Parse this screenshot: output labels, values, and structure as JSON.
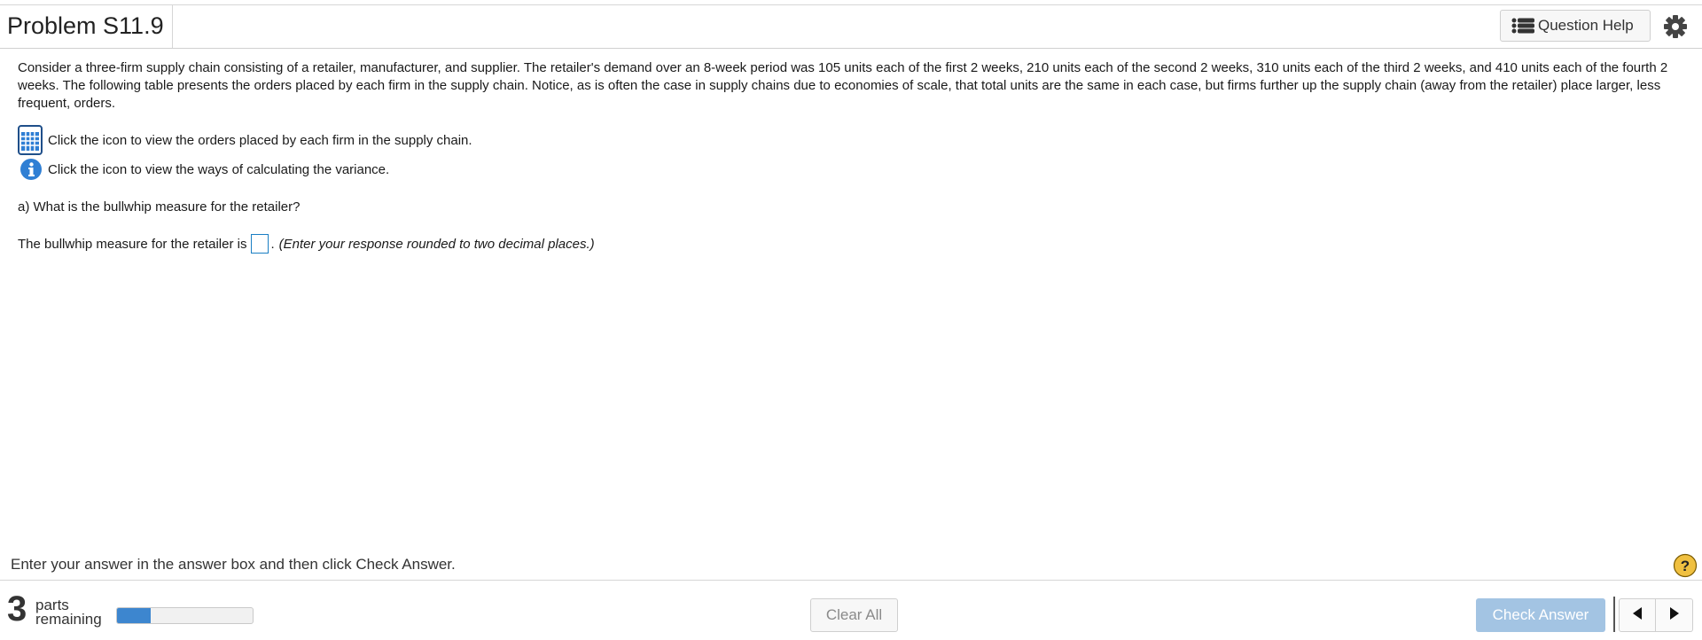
{
  "header": {
    "title": "Problem S11.9",
    "question_help_label": "Question Help",
    "question_help_icon": "list-icon",
    "settings_icon": "gear-icon"
  },
  "problem": {
    "paragraph": "Consider a three-firm supply chain consisting of a retailer, manufacturer, and supplier. The retailer's demand over an 8-week period was 105 units each of the first 2 weeks, 210 units each of the second 2 weeks, 310 units each of the third 2 weeks, and 410 units each of the fourth 2 weeks. The following table presents the orders placed by each firm in the supply chain. Notice, as is often the case in supply chains due to economies of scale, that total units are the same in each case, but firms further up the supply chain (away from the retailer) place larger, less frequent, orders.",
    "table_link_text": "Click the icon to view the orders placed by each firm in the supply chain.",
    "table_icon": "table-icon",
    "info_link_text": "Click the icon to view the ways of calculating the variance.",
    "info_icon": "info-icon",
    "question": "a) What is the bullwhip measure for the retailer?",
    "answer_prefix": "The bullwhip measure for the retailer is",
    "answer_value": "",
    "answer_suffix": ".",
    "answer_hint": "(Enter your response rounded to two decimal places.)"
  },
  "footer": {
    "instruction": "Enter your answer in the answer box and then click Check Answer.",
    "help_icon": "question-mark-icon",
    "parts_count": "3",
    "parts_label_line1": "parts",
    "parts_label_line2": "remaining",
    "progress_fraction": 0.25,
    "clear_all_label": "Clear All",
    "check_answer_label": "Check Answer",
    "prev_icon": "triangle-left-icon",
    "next_icon": "triangle-right-icon"
  },
  "colors": {
    "accent": "#3d86cf",
    "check_answer_bg": "#a3c4e3",
    "answer_box_border": "#1b7fc4",
    "help_badge": "#f0c040"
  }
}
